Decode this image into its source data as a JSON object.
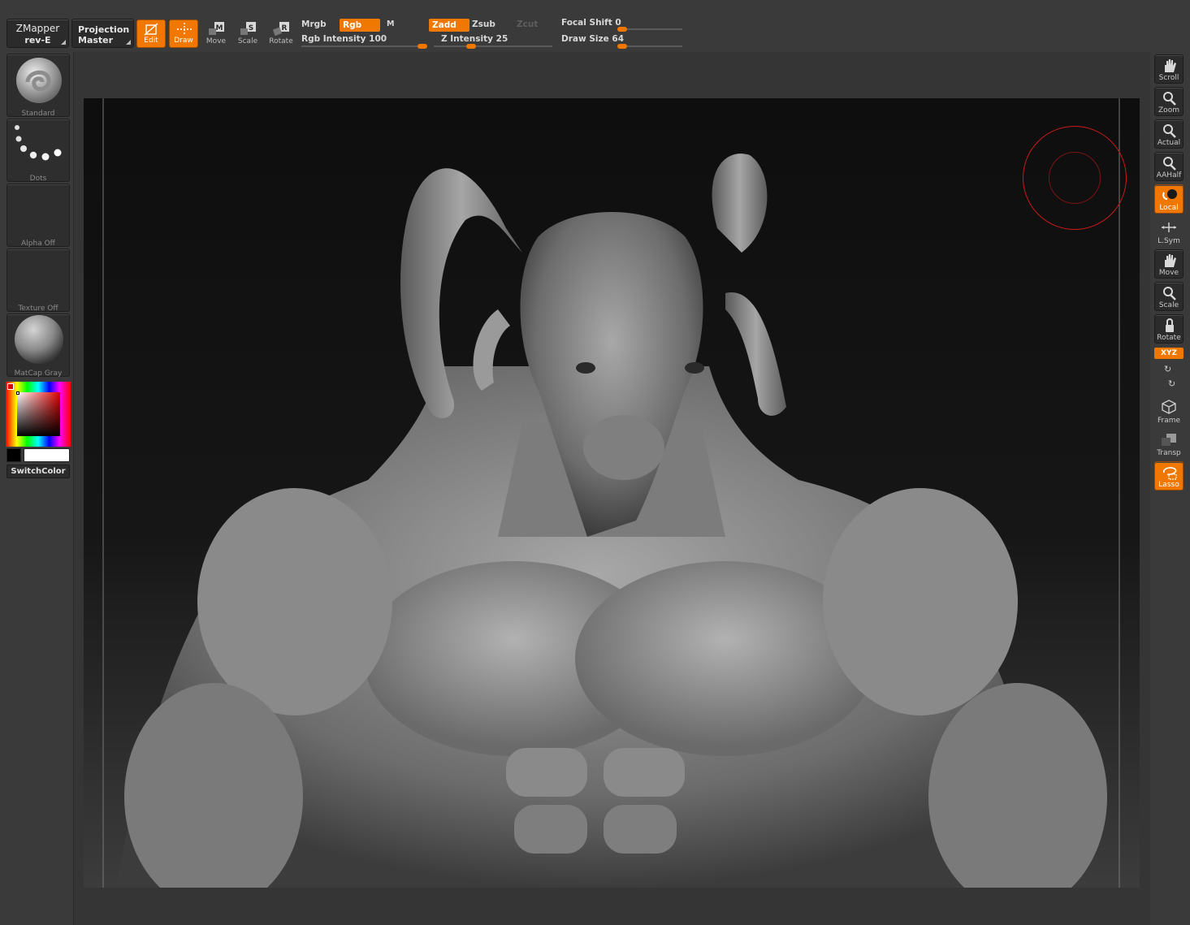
{
  "toolbar": {
    "zmapper": {
      "line1": "ZMapper",
      "line2": "rev-E"
    },
    "projection": {
      "line1": "Projection",
      "line2": "Master"
    },
    "modes": [
      {
        "label": "Edit",
        "icon": "edit-icon",
        "active": true
      },
      {
        "label": "Draw",
        "icon": "draw-icon",
        "active": true
      },
      {
        "label": "Move",
        "icon": "move-icon",
        "active": false
      },
      {
        "label": "Scale",
        "icon": "scale-icon",
        "active": false
      },
      {
        "label": "Rotate",
        "icon": "rotate-icon",
        "active": false
      }
    ],
    "mrgb": "Mrgb",
    "rgb": "Rgb",
    "m": "M",
    "rgb_intensity": {
      "label": "Rgb Intensity",
      "value": "100",
      "fraction": 1.0
    },
    "zadd": "Zadd",
    "zsub": "Zsub",
    "zcut": "Zcut",
    "z_intensity": {
      "label": "Z Intensity",
      "value": "25",
      "fraction": 0.25
    },
    "focal_shift": {
      "label": "Focal Shift",
      "value": "0",
      "fraction": 0.0
    },
    "draw_size": {
      "label": "Draw Size",
      "value": "64",
      "fraction": 0.0
    }
  },
  "left": {
    "brush": "Standard",
    "stroke": "Dots",
    "alpha": "Alpha Off",
    "texture": "Texture Off",
    "material": "MatCap Gray",
    "switch_color": "SwitchColor",
    "main_color": "#ffffff",
    "secondary_color": "#000000"
  },
  "right": {
    "buttons": [
      {
        "label": "Scroll",
        "icon": "scroll-hand-icon",
        "active": false
      },
      {
        "label": "Zoom",
        "icon": "zoom-icon",
        "active": false
      },
      {
        "label": "Actual",
        "icon": "actual-size-icon",
        "active": false
      },
      {
        "label": "AAHalf",
        "icon": "aahalf-icon",
        "active": false
      },
      {
        "label": "Local",
        "icon": "local-icon",
        "active": true
      },
      {
        "label": "L.Sym",
        "icon": "local-symmetry-icon",
        "active": false
      },
      {
        "label": "Move",
        "icon": "move-hand-icon",
        "active": false
      },
      {
        "label": "Scale",
        "icon": "scale-zoom-icon",
        "active": false
      },
      {
        "label": "Rotate",
        "icon": "rotate-lock-icon",
        "active": false
      }
    ],
    "xyz": "XYZ",
    "lower": [
      {
        "label": "Frame",
        "icon": "frame-cube-icon",
        "active": false
      },
      {
        "label": "Transp",
        "icon": "transparency-icon",
        "active": false
      },
      {
        "label": "Lasso",
        "icon": "lasso-icon",
        "active": true
      }
    ]
  },
  "colors": {
    "accent": "#f07800",
    "panel": "#3a3a3a",
    "brush_ring": "#cc1a1a"
  }
}
